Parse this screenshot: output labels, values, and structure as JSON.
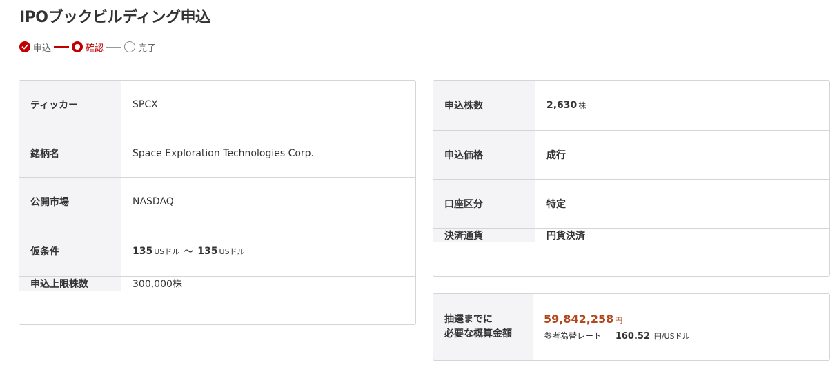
{
  "page": {
    "title": "IPOブックビルディング申込"
  },
  "stepper": {
    "steps": [
      {
        "label": "申込",
        "state": "done"
      },
      {
        "label": "確認",
        "state": "current"
      },
      {
        "label": "完了",
        "state": "todo"
      }
    ]
  },
  "colors": {
    "accent": "#c00000",
    "amount": "#b4471d",
    "label_bg": "#f4f4f6",
    "border": "#d5d5d5"
  },
  "stock_info": {
    "ticker": {
      "label": "ティッカー",
      "value": "SPCX"
    },
    "name": {
      "label": "銘柄名",
      "value": "Space Exploration Technologies Corp."
    },
    "market": {
      "label": "公開市場",
      "value": "NASDAQ"
    },
    "price_range": {
      "label": "仮条件",
      "low": "135",
      "high": "135",
      "unit": "USドル",
      "separator": "〜"
    },
    "max_shares": {
      "label": "申込上限株数",
      "value": "300,000株"
    }
  },
  "order": {
    "shares": {
      "label": "申込株数",
      "value": "2,630",
      "unit": "株"
    },
    "price": {
      "label": "申込価格",
      "value": "成行"
    },
    "account": {
      "label": "口座区分",
      "value": "特定"
    },
    "settlement": {
      "label": "決済通貨",
      "value": "円貨決済"
    }
  },
  "total": {
    "label_line1": "抽選までに",
    "label_line2": "必要な概算金額",
    "amount": "59,842,258",
    "amount_unit": "円",
    "rate_label": "参考為替レート",
    "rate_value": "160.52",
    "rate_unit": "円/USドル"
  }
}
